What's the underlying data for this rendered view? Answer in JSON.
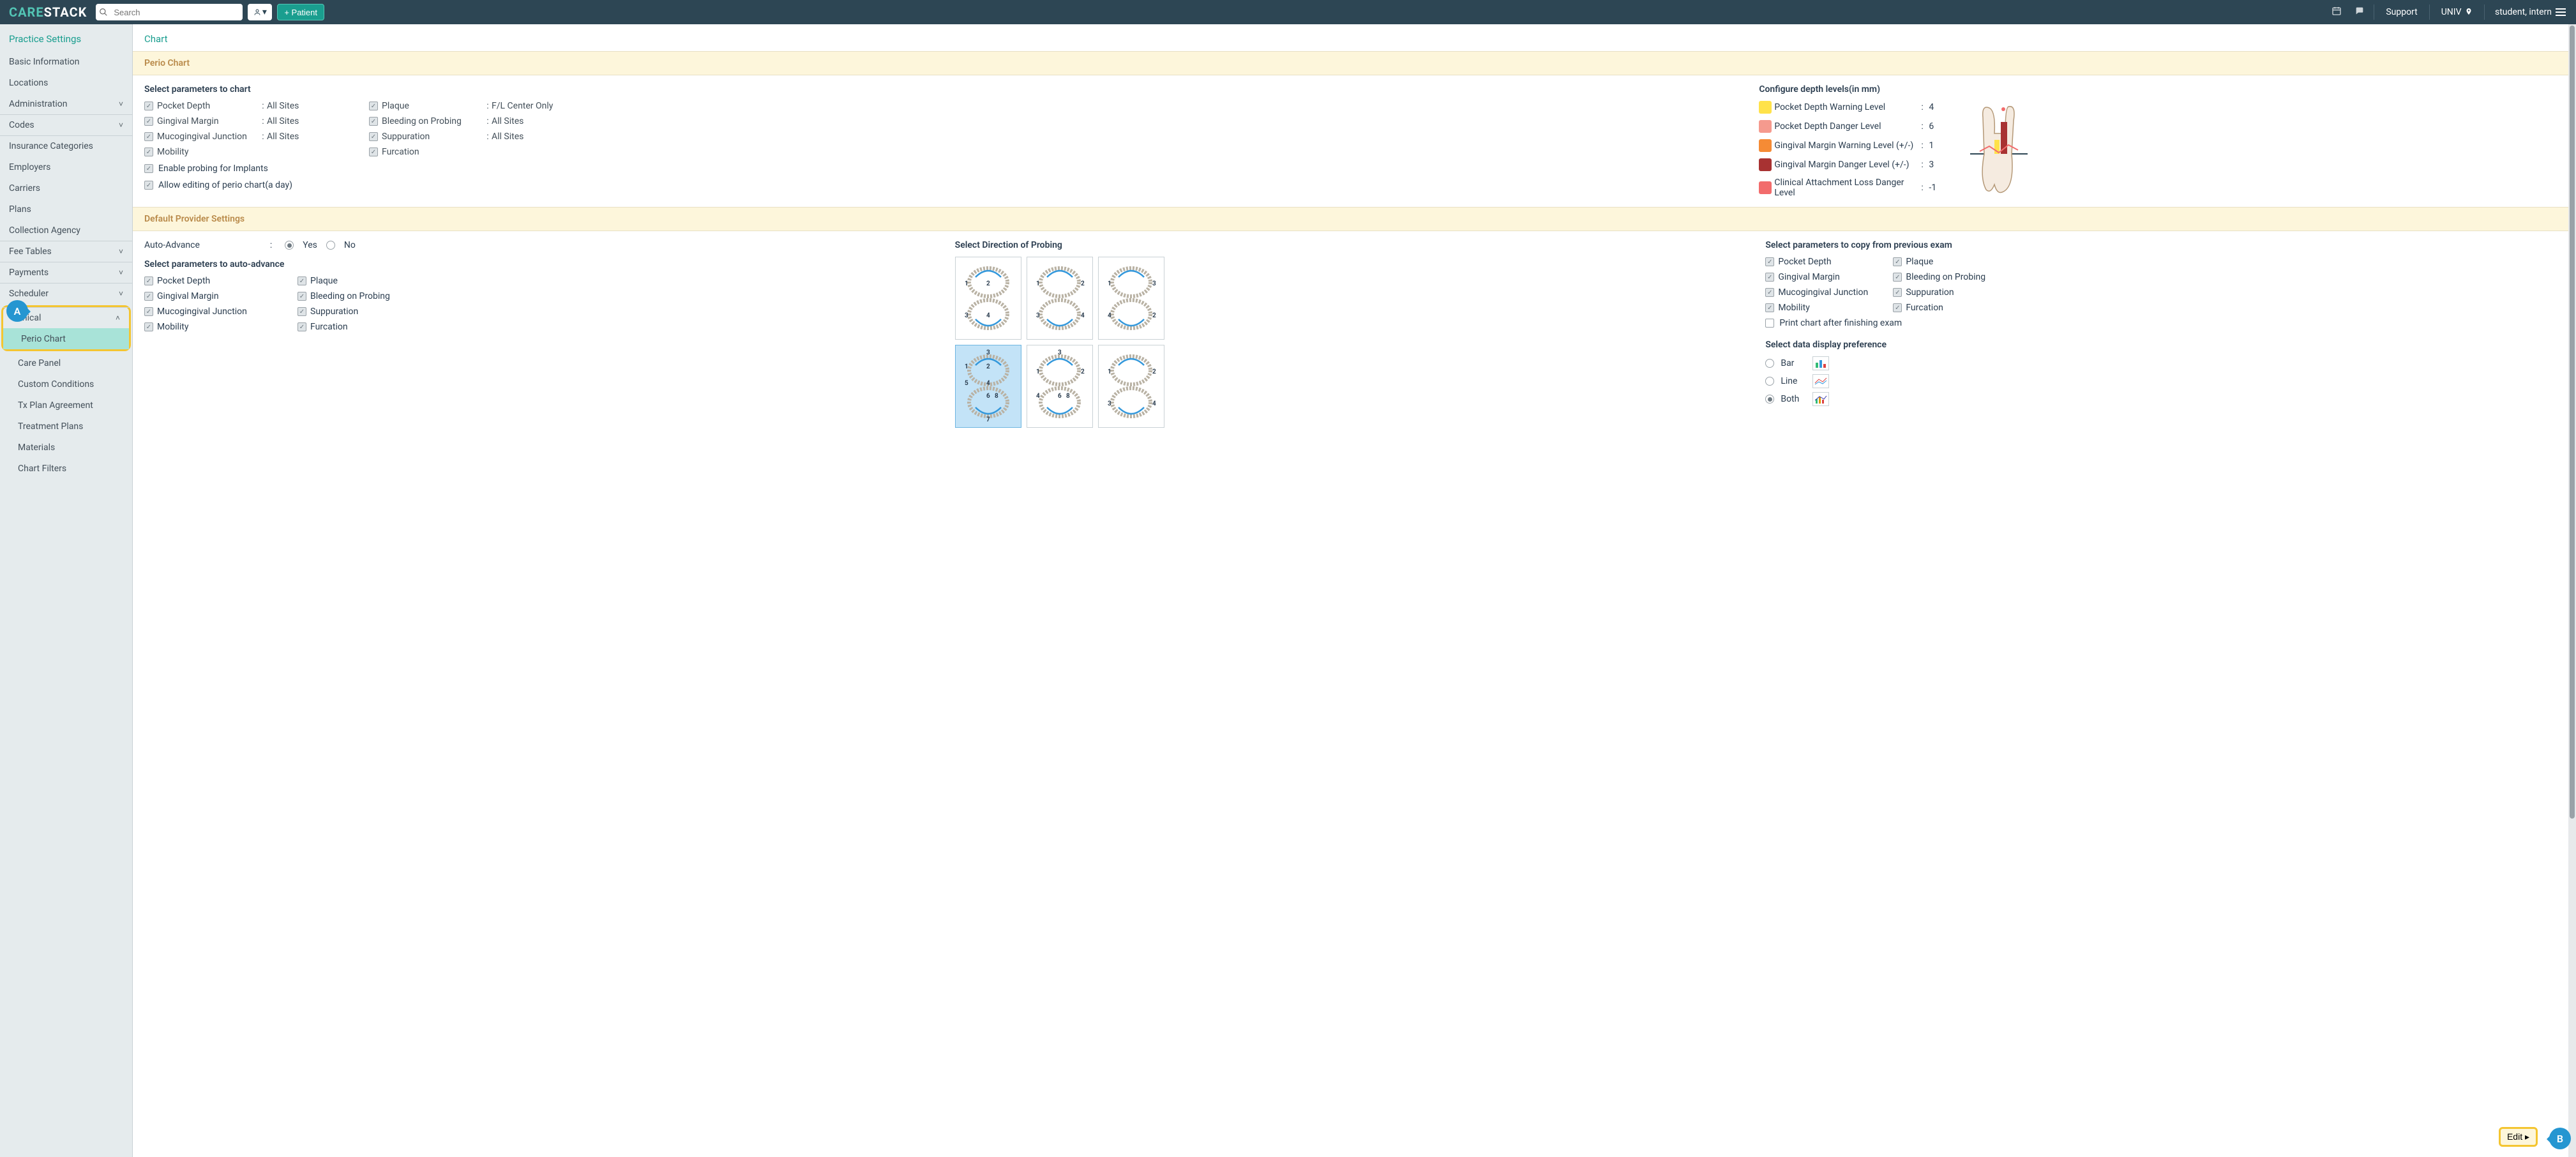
{
  "topbar": {
    "logo_care": "CAR",
    "logo_e": "E",
    "logo_stack": "STACK",
    "search_placeholder": "Search",
    "patient_btn": "+ Patient",
    "support": "Support",
    "location": "UNIV",
    "user": "student, intern"
  },
  "sidebar": {
    "title": "Practice Settings",
    "items": [
      {
        "label": "Basic Information",
        "chev": false
      },
      {
        "label": "Locations",
        "chev": false
      },
      {
        "label": "Administration",
        "chev": true
      },
      {
        "label": "Codes",
        "chev": true,
        "sep": true
      },
      {
        "label": "Insurance Categories",
        "chev": false,
        "sep": true
      },
      {
        "label": "Employers",
        "chev": false
      },
      {
        "label": "Carriers",
        "chev": false
      },
      {
        "label": "Plans",
        "chev": false
      },
      {
        "label": "Collection Agency",
        "chev": false
      },
      {
        "label": "Fee Tables",
        "chev": true,
        "sep": true
      },
      {
        "label": "Payments",
        "chev": true,
        "sep": true
      },
      {
        "label": "Scheduler",
        "chev": true,
        "sep": true
      }
    ],
    "clinical": {
      "label": "Clinical",
      "chev_up": true
    },
    "clinical_sub": [
      {
        "label": "Perio Chart",
        "active": true
      },
      {
        "label": "Care Panel"
      },
      {
        "label": "Custom Conditions"
      },
      {
        "label": "Tx Plan Agreement"
      },
      {
        "label": "Treatment Plans"
      },
      {
        "label": "Materials"
      },
      {
        "label": "Chart Filters"
      }
    ]
  },
  "main": {
    "title": "Chart",
    "perio_section": "Perio Chart",
    "params_head": "Select parameters to chart",
    "params_left": [
      {
        "label": "Pocket Depth",
        "val": "All Sites"
      },
      {
        "label": "Gingival Margin",
        "val": "All Sites"
      },
      {
        "label": "Mucogingival Junction",
        "val": "All Sites"
      },
      {
        "label": "Mobility",
        "val": ""
      }
    ],
    "params_mid": [
      {
        "label": "Plaque",
        "val": "F/L Center Only"
      },
      {
        "label": "Bleeding on Probing",
        "val": "All Sites"
      },
      {
        "label": "Suppuration",
        "val": "All Sites"
      },
      {
        "label": "Furcation",
        "val": ""
      }
    ],
    "extra1": "Enable probing for Implants",
    "extra2": "Allow editing of perio chart(a day)",
    "depth_head": "Configure depth levels(in mm)",
    "depth": [
      {
        "label": "Pocket Depth Warning Level",
        "val": "4",
        "sw": "sw1"
      },
      {
        "label": "Pocket Depth Danger Level",
        "val": "6",
        "sw": "sw2"
      },
      {
        "label": "Gingival Margin Warning Level (+/-)",
        "val": "1",
        "sw": "sw3"
      },
      {
        "label": "Gingival Margin Danger Level (+/-)",
        "val": "3",
        "sw": "sw4"
      },
      {
        "label": "Clinical Attachment Loss Danger Level",
        "val": "-1",
        "sw": "sw5"
      }
    ],
    "provider_section": "Default Provider Settings",
    "auto_adv": {
      "label": "Auto-Advance",
      "yes": "Yes",
      "no": "No"
    },
    "auto_head": "Select parameters to auto-advance",
    "auto_left": [
      "Pocket Depth",
      "Gingival Margin",
      "Mucogingival Junction",
      "Mobility"
    ],
    "auto_right": [
      "Plaque",
      "Bleeding on Probing",
      "Suppuration",
      "Furcation"
    ],
    "probe_head": "Select Direction of Probing",
    "probe_labels": {
      "top1": [
        "1",
        "2",
        "3",
        "4"
      ],
      "sel": [
        "3",
        "1",
        "2",
        "5",
        "4",
        "7",
        "6",
        "8"
      ],
      "bot2": [
        "3",
        "1",
        "2",
        "4",
        "6",
        "8"
      ],
      "bot3": [
        "1",
        "2",
        "3",
        "4"
      ]
    },
    "copy_head": "Select parameters to copy from previous exam",
    "copy_left": [
      "Pocket Depth",
      "Gingival Margin",
      "Mucogingival Junction",
      "Mobility"
    ],
    "copy_right": [
      "Plaque",
      "Bleeding on Probing",
      "Suppuration",
      "Furcation"
    ],
    "print_after": "Print chart after finishing exam",
    "pref_head": "Select data display preference",
    "pref": {
      "bar": "Bar",
      "line": "Line",
      "both": "Both"
    },
    "edit": "Edit"
  },
  "callouts": {
    "a": "A",
    "b": "B"
  }
}
